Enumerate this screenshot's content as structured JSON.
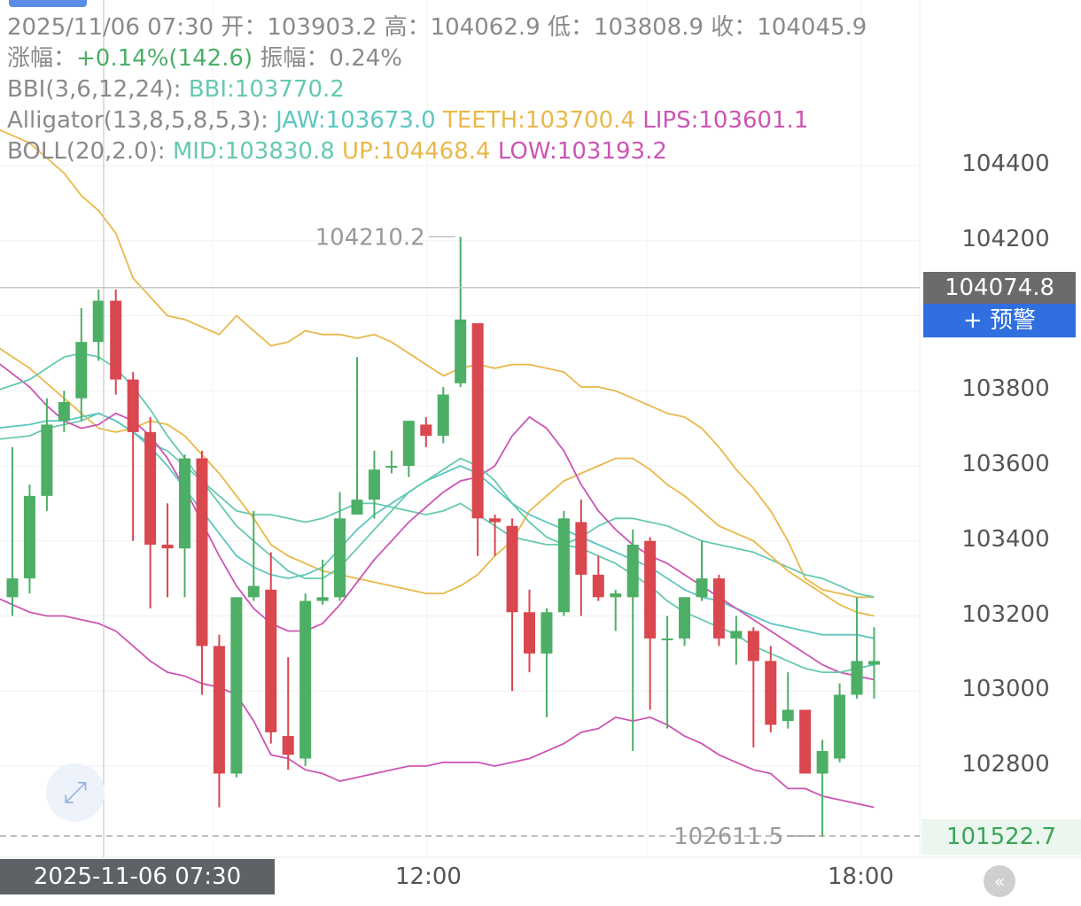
{
  "header": {
    "line1": "2025/11/06 07:30 开：103903.2 高：104062.9 低：103808.9 收：104045.9",
    "change_label": "涨幅：",
    "change_value": "+0.14%(142.6)",
    "amplitude": "振幅：0.24%",
    "bbi_label": "BBI(3,6,12,24):",
    "bbi_value": "BBI:103770.2",
    "alligator_label": "Alligator(13,8,5,8,5,3):",
    "jaw": "JAW:103673.0",
    "teeth": "TEETH:103700.4",
    "lips": "LIPS:103601.1",
    "boll_label": "BOLL(20,2.0):",
    "mid": "MID:103830.8",
    "up": "UP:104468.4",
    "low": "LOW:103193.2"
  },
  "price_axis": [
    "104400",
    "104200",
    "103800",
    "103600",
    "103400",
    "103200",
    "103000",
    "102800"
  ],
  "current_price": "104074.8",
  "alert_button": "+ 预警",
  "low_marker": "101522.7",
  "high_annotation": "104210.2",
  "low_annotation": "102611.5",
  "crosshair_time": "2025-11-06 07:30",
  "time_axis": [
    "12:00",
    "18:00"
  ],
  "colors": {
    "up": "#4caf65",
    "down": "#d9474f",
    "teal": "#66c9b0",
    "gold": "#e9b84a",
    "magenta": "#cc55b4",
    "cyan": "#5cc7c0"
  },
  "chart_data": {
    "type": "candlestick",
    "ylim": [
      102611.5,
      104210.2
    ],
    "candles": [
      {
        "o": 103250,
        "h": 103650,
        "c": 103300,
        "l": 103200
      },
      {
        "o": 103300,
        "h": 103550,
        "c": 103520,
        "l": 103260
      },
      {
        "o": 103520,
        "h": 103780,
        "c": 103710,
        "l": 103480
      },
      {
        "o": 103720,
        "h": 103800,
        "c": 103770,
        "l": 103690
      },
      {
        "o": 103780,
        "h": 104020,
        "c": 103930,
        "l": 103720
      },
      {
        "o": 103930,
        "h": 104070,
        "c": 104040,
        "l": 103880
      },
      {
        "o": 104040,
        "h": 104070,
        "c": 103830,
        "l": 103790
      },
      {
        "o": 103830,
        "h": 103850,
        "c": 103690,
        "l": 103400
      },
      {
        "o": 103690,
        "h": 103730,
        "c": 103390,
        "l": 103220
      },
      {
        "o": 103390,
        "h": 103500,
        "c": 103380,
        "l": 103250
      },
      {
        "o": 103380,
        "h": 103630,
        "c": 103620,
        "l": 103250
      },
      {
        "o": 103620,
        "h": 103640,
        "c": 103120,
        "l": 102990
      },
      {
        "o": 103120,
        "h": 103150,
        "c": 102780,
        "l": 102690
      },
      {
        "o": 102780,
        "h": 103240,
        "c": 103250,
        "l": 102770
      },
      {
        "o": 103250,
        "h": 103480,
        "c": 103280,
        "l": 103240
      },
      {
        "o": 103270,
        "h": 103370,
        "c": 102890,
        "l": 102860
      },
      {
        "o": 102880,
        "h": 103090,
        "c": 102830,
        "l": 102790
      },
      {
        "o": 102820,
        "h": 103260,
        "c": 103240,
        "l": 102800
      },
      {
        "o": 103240,
        "h": 103350,
        "c": 103250,
        "l": 103230
      },
      {
        "o": 103250,
        "h": 103530,
        "c": 103460,
        "l": 103240
      },
      {
        "o": 103470,
        "h": 103890,
        "c": 103510,
        "l": 103490
      },
      {
        "o": 103510,
        "h": 103640,
        "c": 103590,
        "l": 103460
      },
      {
        "o": 103600,
        "h": 103640,
        "c": 103600,
        "l": 103580
      },
      {
        "o": 103600,
        "h": 103720,
        "c": 103720,
        "l": 103570
      },
      {
        "o": 103710,
        "h": 103730,
        "c": 103680,
        "l": 103650
      },
      {
        "o": 103680,
        "h": 103810,
        "c": 103790,
        "l": 103660
      },
      {
        "o": 103820,
        "h": 104210.2,
        "c": 103990,
        "l": 103810
      },
      {
        "o": 103980,
        "h": 103980,
        "c": 103460,
        "l": 103360
      },
      {
        "o": 103460,
        "h": 103470,
        "c": 103450,
        "l": 103360
      },
      {
        "o": 103440,
        "h": 103460,
        "c": 103210,
        "l": 103000
      },
      {
        "o": 103210,
        "h": 103270,
        "c": 103100,
        "l": 103050
      },
      {
        "o": 103100,
        "h": 103220,
        "c": 103210,
        "l": 102930
      },
      {
        "o": 103210,
        "h": 103480,
        "c": 103460,
        "l": 103200
      },
      {
        "o": 103450,
        "h": 103510,
        "c": 103310,
        "l": 103200
      },
      {
        "o": 103310,
        "h": 103360,
        "c": 103250,
        "l": 103240
      },
      {
        "o": 103250,
        "h": 103270,
        "c": 103260,
        "l": 103160
      },
      {
        "o": 103250,
        "h": 103430,
        "c": 103390,
        "l": 102840
      },
      {
        "o": 103400,
        "h": 103410,
        "c": 103140,
        "l": 102950
      },
      {
        "o": 103140,
        "h": 103200,
        "c": 103140,
        "l": 102900
      },
      {
        "o": 103140,
        "h": 103250,
        "c": 103250,
        "l": 103120
      },
      {
        "o": 103250,
        "h": 103400,
        "c": 103300,
        "l": 103240
      },
      {
        "o": 103300,
        "h": 103310,
        "c": 103140,
        "l": 103120
      },
      {
        "o": 103140,
        "h": 103200,
        "c": 103160,
        "l": 103070
      },
      {
        "o": 103160,
        "h": 103170,
        "c": 103080,
        "l": 102850
      },
      {
        "o": 103080,
        "h": 103120,
        "c": 102910,
        "l": 102890
      },
      {
        "o": 102920,
        "h": 103050,
        "c": 102950,
        "l": 102900
      },
      {
        "o": 102950,
        "h": 102950,
        "c": 102780,
        "l": 102780
      },
      {
        "o": 102780,
        "h": 102870,
        "c": 102840,
        "l": 102611.5
      },
      {
        "o": 102820,
        "h": 103020,
        "c": 102990,
        "l": 102810
      },
      {
        "o": 102990,
        "h": 103250,
        "c": 103080,
        "l": 102980
      },
      {
        "o": 103070,
        "h": 103170,
        "c": 103080,
        "l": 102980
      }
    ],
    "lines": [
      {
        "name": "UP",
        "color": "#e9b84a",
        "values": [
          104500,
          104460,
          104420,
          104380,
          104320,
          104280,
          104220,
          104100,
          104050,
          104000,
          103990,
          103970,
          103950,
          104000,
          103960,
          103920,
          103930,
          103960,
          103950,
          103950,
          103940,
          103950,
          103930,
          103900,
          103870,
          103840,
          103860,
          103870,
          103860,
          103870,
          103870,
          103860,
          103850,
          103810,
          103810,
          103800,
          103780,
          103760,
          103740,
          103730,
          103700,
          103650,
          103590,
          103540,
          103480,
          103400,
          103300,
          103270,
          103260,
          103250,
          103250
        ]
      },
      {
        "name": "LOW",
        "color": "#cc55b4",
        "values": [
          103250,
          103210,
          103200,
          103200,
          103190,
          103180,
          103160,
          103120,
          103080,
          103050,
          103040,
          103020,
          103010,
          102990,
          102920,
          102830,
          102820,
          102790,
          102780,
          102760,
          102770,
          102780,
          102790,
          102800,
          102800,
          102810,
          102810,
          102810,
          102800,
          102810,
          102820,
          102840,
          102860,
          102890,
          102900,
          102930,
          102920,
          102930,
          102910,
          102880,
          102860,
          102830,
          102810,
          102790,
          102780,
          102740,
          102740,
          102720,
          102710,
          102700,
          102690
        ]
      },
      {
        "name": "MID",
        "color": "#66c9b0",
        "values": [
          103670,
          103680,
          103700,
          103710,
          103720,
          103740,
          103720,
          103690,
          103660,
          103640,
          103600,
          103560,
          103520,
          103480,
          103470,
          103470,
          103460,
          103450,
          103460,
          103480,
          103500,
          103500,
          103490,
          103480,
          103470,
          103480,
          103500,
          103470,
          103440,
          103410,
          103400,
          103390,
          103390,
          103410,
          103440,
          103460,
          103460,
          103450,
          103440,
          103420,
          103400,
          103390,
          103380,
          103370,
          103350,
          103330,
          103310,
          103300,
          103280,
          103260,
          103250
        ]
      },
      {
        "name": "TEETH",
        "color": "#e9b84a",
        "values": [
          103920,
          103860,
          103820,
          103780,
          103740,
          103700,
          103690,
          103700,
          103720,
          103710,
          103680,
          103630,
          103580,
          103520,
          103460,
          103390,
          103360,
          103340,
          103320,
          103310,
          103300,
          103290,
          103280,
          103270,
          103260,
          103260,
          103280,
          103310,
          103360,
          103400,
          103480,
          103520,
          103560,
          103580,
          103600,
          103620,
          103620,
          103590,
          103550,
          103520,
          103480,
          103440,
          103420,
          103400,
          103360,
          103320,
          103290,
          103260,
          103230,
          103210,
          103200
        ]
      },
      {
        "name": "JAW",
        "color": "#5cc7c0",
        "values": [
          103700,
          103710,
          103720,
          103720,
          103730,
          103740,
          103720,
          103690,
          103650,
          103600,
          103540,
          103480,
          103420,
          103360,
          103330,
          103310,
          103300,
          103310,
          103330,
          103380,
          103430,
          103470,
          103500,
          103530,
          103560,
          103580,
          103600,
          103580,
          103540,
          103500,
          103470,
          103450,
          103430,
          103410,
          103390,
          103370,
          103350,
          103330,
          103300,
          103270,
          103250,
          103240,
          103220,
          103200,
          103180,
          103170,
          103160,
          103150,
          103150,
          103150,
          103140
        ]
      },
      {
        "name": "LIPS",
        "color": "#cc55b4",
        "values": [
          103880,
          103810,
          103760,
          103720,
          103700,
          103710,
          103740,
          103720,
          103680,
          103620,
          103540,
          103450,
          103360,
          103280,
          103220,
          103180,
          103160,
          103160,
          103180,
          103230,
          103290,
          103350,
          103400,
          103450,
          103490,
          103530,
          103560,
          103570,
          103600,
          103680,
          103730,
          103700,
          103640,
          103550,
          103480,
          103430,
          103390,
          103360,
          103340,
          103310,
          103280,
          103250,
          103220,
          103190,
          103160,
          103130,
          103100,
          103070,
          103050,
          103040,
          103030
        ]
      },
      {
        "name": "BBI",
        "color": "#66c9b0",
        "values": [
          103800,
          103830,
          103860,
          103890,
          103900,
          103890,
          103860,
          103810,
          103750,
          103680,
          103620,
          103560,
          103500,
          103440,
          103400,
          103360,
          103320,
          103300,
          103300,
          103330,
          103380,
          103430,
          103480,
          103530,
          103560,
          103590,
          103620,
          103600,
          103560,
          103500,
          103450,
          103410,
          103390,
          103380,
          103360,
          103340,
          103310,
          103280,
          103240,
          103210,
          103190,
          103170,
          103150,
          103120,
          103100,
          103080,
          103060,
          103050,
          103050,
          103060,
          103070
        ]
      }
    ]
  }
}
